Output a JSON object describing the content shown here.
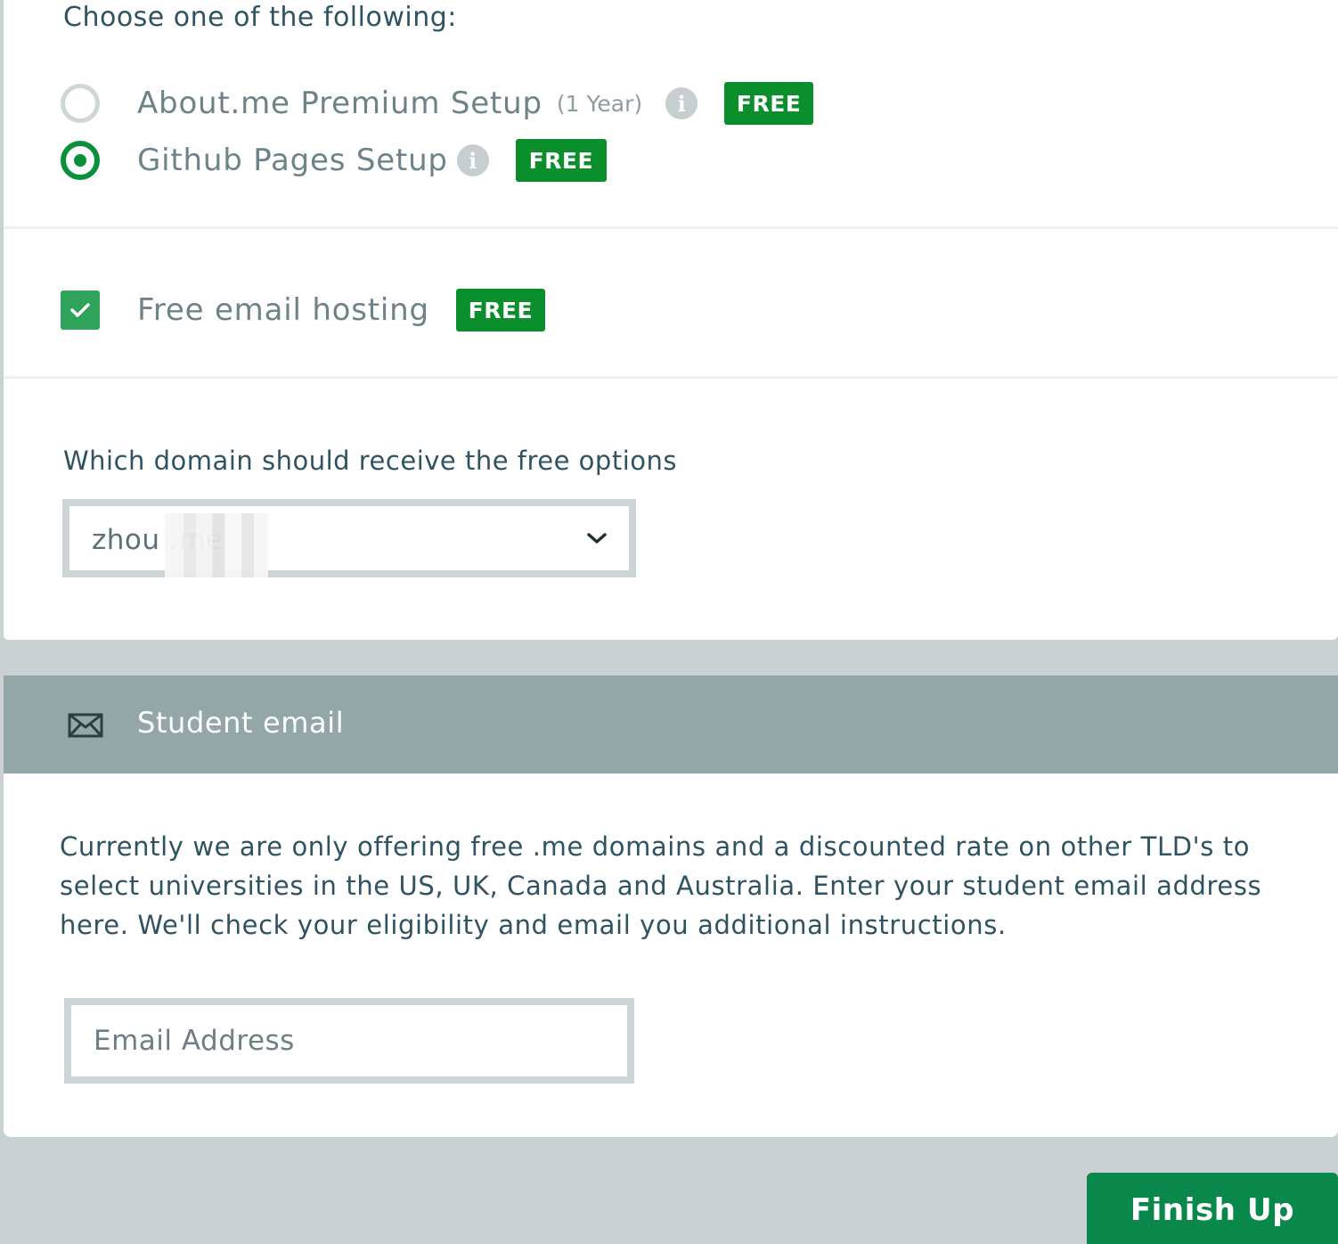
{
  "setup": {
    "heading": "Choose one of the following:",
    "options": [
      {
        "label": "About.me Premium Setup",
        "sub": "(1 Year)",
        "badge": "FREE",
        "selected": false
      },
      {
        "label": "Github Pages Setup",
        "badge": "FREE",
        "selected": true
      }
    ]
  },
  "email_hosting": {
    "label": "Free email hosting",
    "badge": "FREE",
    "checked": true
  },
  "domain": {
    "label": "Which domain should receive the free options",
    "selected_value": "zhou .me"
  },
  "student_email": {
    "title": "Student email",
    "description": "Currently we are only offering free .me domains and a discounted rate on other TLD's to select universities in the US, UK, Canada and Australia. Enter your student email address here. We'll check your eligibility and email you additional instructions.",
    "input_placeholder": "Email Address"
  },
  "actions": {
    "finish_label": "Finish Up"
  },
  "colors": {
    "accent_green": "#0a8f2c",
    "header_bg": "#94a7a8",
    "page_bg": "#c9d1d3"
  },
  "icons": {
    "info": "info-icon",
    "mail": "envelope-icon",
    "chevron": "chevron-down-icon",
    "check": "check-icon"
  }
}
